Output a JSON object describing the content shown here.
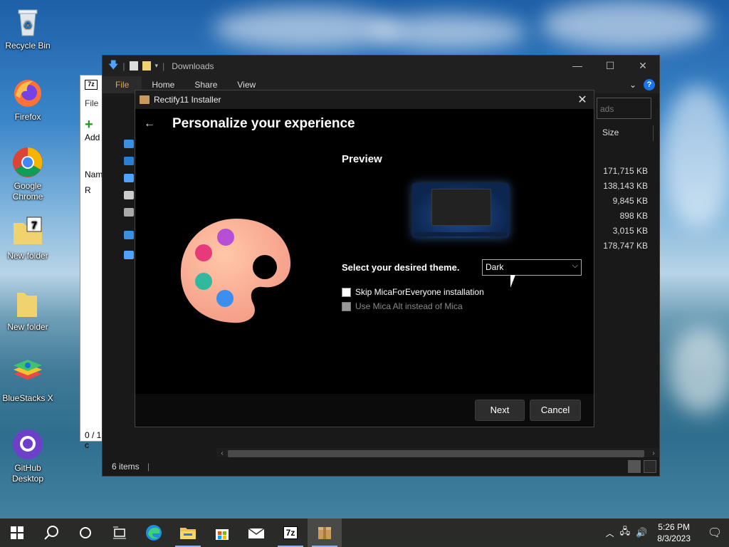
{
  "desktop": {
    "icons": [
      {
        "label": "Recycle Bin",
        "icon": "recycle-bin-icon"
      },
      {
        "label": "Firefox",
        "icon": "firefox-icon"
      },
      {
        "label": "Google\nChrome",
        "icon": "chrome-icon"
      },
      {
        "label": "New folder",
        "icon": "folder-7z-icon"
      },
      {
        "label": "New folder",
        "icon": "folder-icon"
      },
      {
        "label": "BlueStacks X",
        "icon": "bluestacks-icon"
      },
      {
        "label": "GitHub\nDesktop",
        "icon": "github-icon"
      }
    ]
  },
  "explorer_back": {
    "menu_file": "File",
    "add_label": "Add",
    "col_name": "Nam",
    "row_item": "R",
    "status": "0 / 1 c"
  },
  "explorer": {
    "title": "Downloads",
    "tabs": [
      "File",
      "Home",
      "Share",
      "View"
    ],
    "search_placeholder": "ads",
    "size_header": "Size",
    "sizes": [
      "171,715 KB",
      "138,143 KB",
      "9,845 KB",
      "898 KB",
      "3,015 KB",
      "178,747 KB"
    ],
    "status": "6 items"
  },
  "installer": {
    "title": "Rectify11 Installer",
    "heading": "Personalize your experience",
    "preview_label": "Preview",
    "theme_label": "Select your desired theme.",
    "theme_value": "Dark",
    "skip_mica_label": "Skip MicaForEveryone installation",
    "mica_alt_label": "Use Mica Alt instead of Mica",
    "next_button": "Next",
    "cancel_button": "Cancel"
  },
  "taskbar": {
    "time": "5:26 PM",
    "date": "8/3/2023"
  }
}
